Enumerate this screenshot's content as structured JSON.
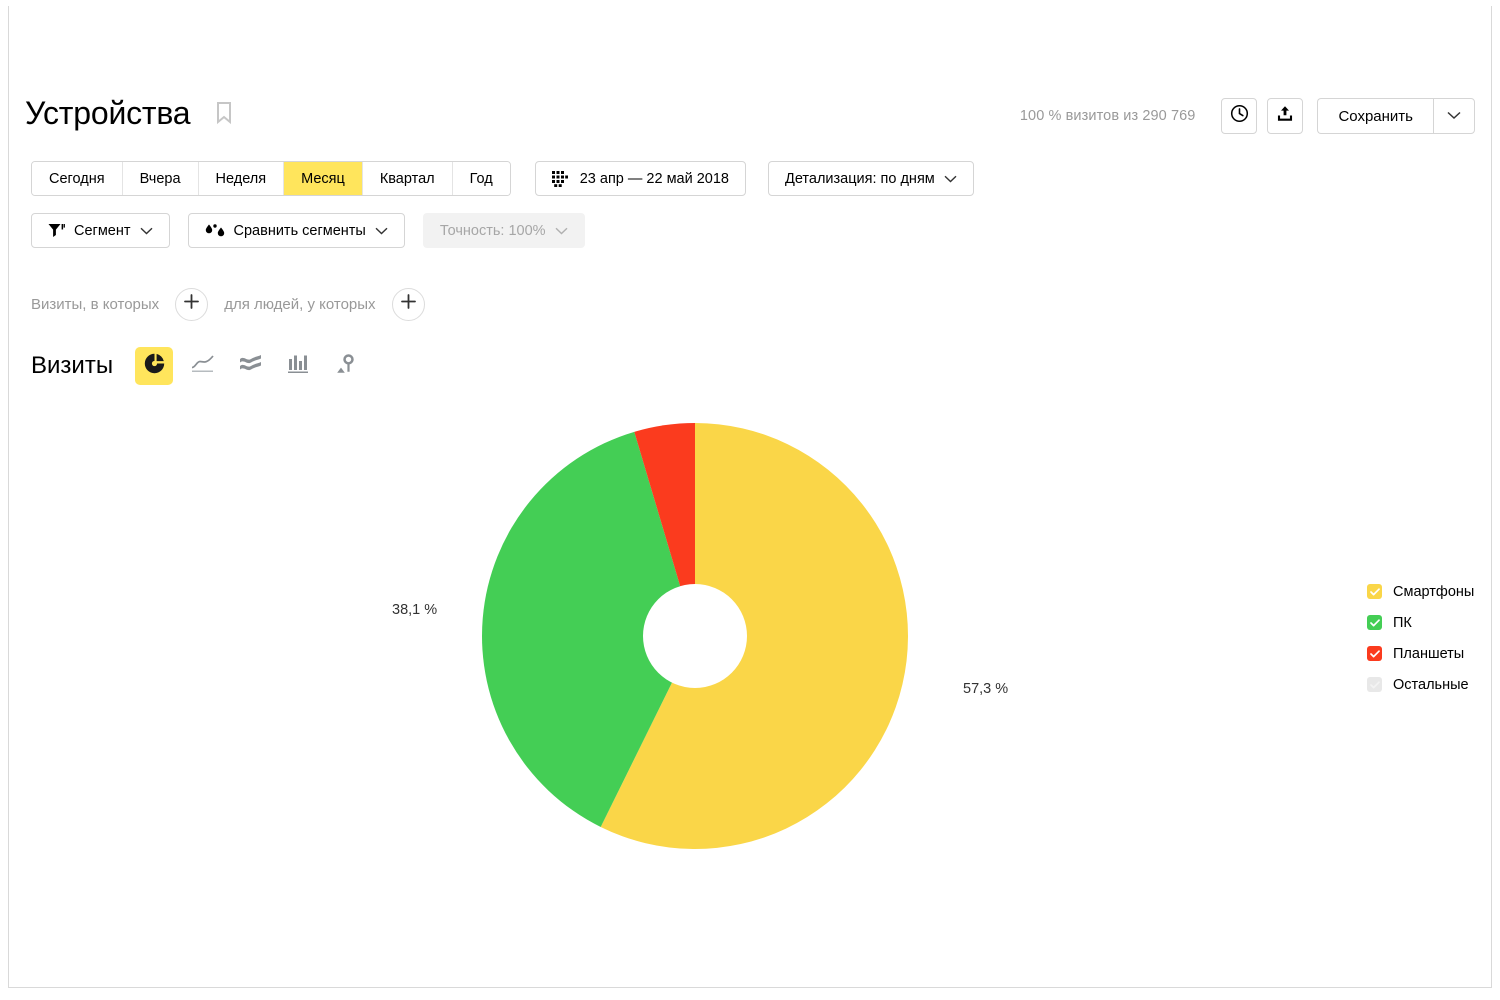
{
  "header": {
    "title": "Устройства",
    "bookmark_icon": "bookmark-icon",
    "visits_summary": "100 % визитов из 290 769",
    "history_icon": "clock-icon",
    "export_icon": "export-icon",
    "save_label": "Сохранить",
    "save_caret_icon": "chevron-down-icon"
  },
  "period": {
    "presets": [
      {
        "label": "Сегодня",
        "active": false
      },
      {
        "label": "Вчера",
        "active": false
      },
      {
        "label": "Неделя",
        "active": false
      },
      {
        "label": "Месяц",
        "active": true
      },
      {
        "label": "Квартал",
        "active": false
      },
      {
        "label": "Год",
        "active": false
      }
    ],
    "date_range": "23 апр — 22 май 2018",
    "calendar_icon": "calendar-icon",
    "detalization": "Детализация: по дням",
    "detalization_caret": "chevron-down-icon"
  },
  "segments": {
    "segment_label": "Сегмент",
    "segment_icon": "funnel-icon",
    "compare_label": "Сравнить сегменты",
    "compare_icon": "compare-drops-icon",
    "accuracy_label": "Точность: 100%",
    "accuracy_disabled": true,
    "caret_icon": "chevron-down-icon"
  },
  "filters": {
    "visits_label": "Визиты, в которых",
    "people_label": "для людей, у которых",
    "add_icon": "plus-icon"
  },
  "metric": {
    "label": "Визиты",
    "chart_types": [
      {
        "name": "pie-chart-icon",
        "active": true
      },
      {
        "name": "line-chart-icon",
        "active": false
      },
      {
        "name": "area-chart-icon",
        "active": false
      },
      {
        "name": "bar-chart-icon",
        "active": false
      },
      {
        "name": "map-pin-icon",
        "active": false
      }
    ]
  },
  "chart_data": {
    "type": "pie",
    "title": "Устройства",
    "donut": true,
    "inner_radius_ratio": 0.245,
    "start_angle_deg": 0,
    "direction": "clockwise",
    "categories": [
      "Смартфоны",
      "ПК",
      "Планшеты",
      "Остальные"
    ],
    "values": [
      57.3,
      38.1,
      4.6,
      0.0
    ],
    "value_labels": [
      "57,3 %",
      "38,1 %",
      "",
      ""
    ],
    "colors": [
      "#fad648",
      "#44ce55",
      "#fb3b1e",
      "#eeeeee"
    ],
    "unit": "%",
    "total_visits": "290 769",
    "visible_labels": [
      {
        "text": "38,1 %",
        "series": "ПК"
      },
      {
        "text": "57,3 %",
        "series": "Смартфоны"
      }
    ],
    "legend_position": "right",
    "legend": [
      {
        "label": "Смартфоны",
        "color": "#fad648",
        "checked": true
      },
      {
        "label": "ПК",
        "color": "#44ce55",
        "checked": true
      },
      {
        "label": "Планшеты",
        "color": "#fb3b1e",
        "checked": true
      },
      {
        "label": "Остальные",
        "color": "#e8e8e8",
        "checked": false
      }
    ]
  },
  "colors": {
    "accent_yellow": "#ffe55c",
    "smartphones": "#fad648",
    "pc": "#44ce55",
    "tablets": "#fb3b1e",
    "others": "#e8e8e8",
    "border": "#d5d5d5",
    "muted_text": "#999999"
  }
}
